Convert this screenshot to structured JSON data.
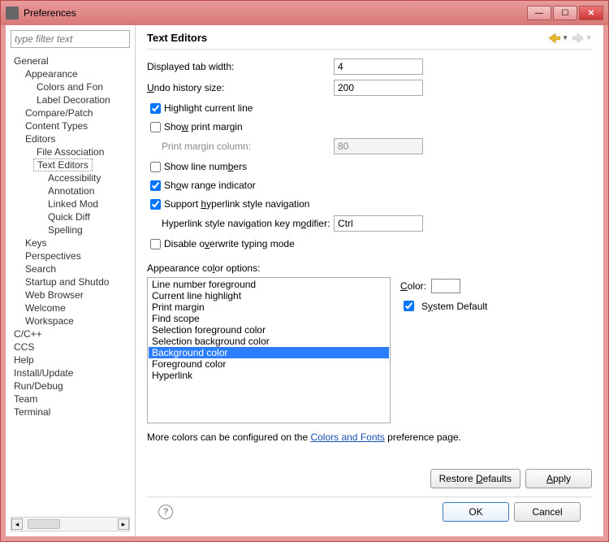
{
  "window": {
    "title": "Preferences"
  },
  "sidebar": {
    "filter_placeholder": "type filter text",
    "tree": [
      {
        "label": "General",
        "level": 0
      },
      {
        "label": "Appearance",
        "level": 1
      },
      {
        "label": "Colors and Fon",
        "level": 2
      },
      {
        "label": "Label Decoration",
        "level": 2
      },
      {
        "label": "Compare/Patch",
        "level": 1
      },
      {
        "label": "Content Types",
        "level": 1
      },
      {
        "label": "Editors",
        "level": 1
      },
      {
        "label": "File Association",
        "level": 2
      },
      {
        "label": "Text Editors",
        "level": 2,
        "selected": true
      },
      {
        "label": "Accessibility",
        "level": 3
      },
      {
        "label": "Annotation",
        "level": 3
      },
      {
        "label": "Linked Mod",
        "level": 3
      },
      {
        "label": "Quick Diff",
        "level": 3
      },
      {
        "label": "Spelling",
        "level": 3
      },
      {
        "label": "Keys",
        "level": 1
      },
      {
        "label": "Perspectives",
        "level": 1
      },
      {
        "label": "Search",
        "level": 1
      },
      {
        "label": "Startup and Shutdo",
        "level": 1
      },
      {
        "label": "Web Browser",
        "level": 1
      },
      {
        "label": "Welcome",
        "level": 1
      },
      {
        "label": "Workspace",
        "level": 1
      },
      {
        "label": "C/C++",
        "level": 0
      },
      {
        "label": "CCS",
        "level": 0
      },
      {
        "label": "Help",
        "level": 0
      },
      {
        "label": "Install/Update",
        "level": 0
      },
      {
        "label": "Run/Debug",
        "level": 0
      },
      {
        "label": "Team",
        "level": 0
      },
      {
        "label": "Terminal",
        "level": 0
      }
    ]
  },
  "page": {
    "title": "Text Editors",
    "tab_width_label": "Displayed tab width:",
    "tab_width_value": "4",
    "undo_label": "Undo history size:",
    "undo_value": "200",
    "highlight_label": "Highlight current line",
    "highlight_checked": true,
    "print_margin_label": "Show print margin",
    "print_margin_checked": false,
    "print_margin_col_label": "Print margin column:",
    "print_margin_col_value": "80",
    "line_numbers_label": "Show line numbers",
    "line_numbers_checked": false,
    "range_label": "Show range indicator",
    "range_checked": true,
    "hyperlink_nav_label": "Support hyperlink style navigation",
    "hyperlink_nav_checked": true,
    "hyperlink_mod_label": "Hyperlink style navigation key modifier:",
    "hyperlink_mod_value": "Ctrl",
    "overwrite_label": "Disable overwrite typing mode",
    "overwrite_checked": false,
    "color_section_label": "Appearance color options:",
    "color_options": [
      "Line number foreground",
      "Current line highlight",
      "Print margin",
      "Find scope",
      "Selection foreground color",
      "Selection background color",
      "Background color",
      "Foreground color",
      "Hyperlink"
    ],
    "color_selected_index": 6,
    "color_label": "Color:",
    "system_default_label": "System Default",
    "system_default_checked": true,
    "info_prefix": "More colors can be configured on the ",
    "info_link": "Colors and Fonts",
    "info_suffix": " preference page.",
    "restore_btn": "Restore Defaults",
    "apply_btn": "Apply"
  },
  "footer": {
    "ok": "OK",
    "cancel": "Cancel"
  }
}
